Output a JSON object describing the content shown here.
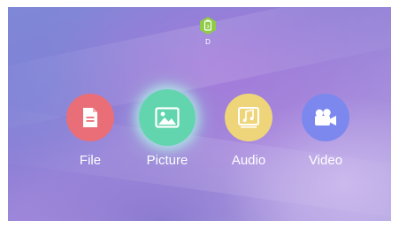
{
  "drive": {
    "label": "D",
    "icon": "usb-drive-icon",
    "color": "#8fcc45"
  },
  "apps": [
    {
      "id": "file",
      "label": "File",
      "icon": "document-icon",
      "color": "#e96e78",
      "selected": false
    },
    {
      "id": "picture",
      "label": "Picture",
      "icon": "image-icon",
      "color": "#63d5ae",
      "selected": true
    },
    {
      "id": "audio",
      "label": "Audio",
      "icon": "music-icon",
      "color": "#efd57a",
      "selected": false
    },
    {
      "id": "video",
      "label": "Video",
      "icon": "camera-icon",
      "color": "#7d88ee",
      "selected": false
    }
  ]
}
